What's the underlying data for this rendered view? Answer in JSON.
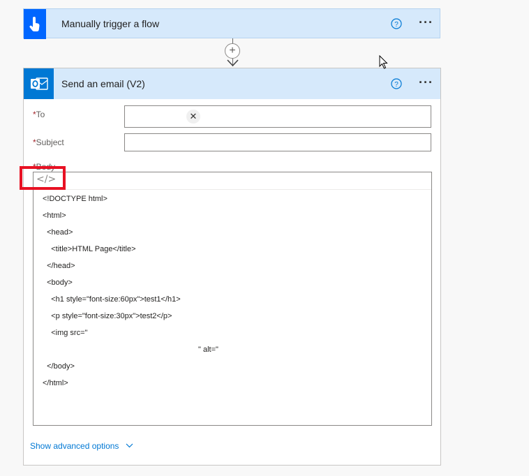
{
  "trigger": {
    "title": "Manually trigger a flow",
    "help_icon": "help-circle-icon",
    "more_icon": "more-options-icon"
  },
  "connector": {
    "add_symbol": "+"
  },
  "action": {
    "title": "Send an email (V2)",
    "help_icon": "help-circle-icon",
    "more_icon": "more-options-icon",
    "fields": {
      "to_label": "To",
      "subject_label": "Subject",
      "body_label": "Body",
      "required_marker": "*"
    },
    "code_toggle": "</>",
    "body_lines": [
      "<!DOCTYPE html>",
      "<html>",
      "  <head>",
      "    <title>HTML Page</title>",
      "  </head>",
      "  <body>",
      "    <h1 style=\"font-size:60px\">test1</h1>",
      "    <p style=\"font-size:30px\">test2</p>",
      "    <img src=\"",
      "\" alt=\"",
      "  </body>",
      "</html>"
    ],
    "advanced_label": "Show advanced options"
  },
  "colors": {
    "accent": "#0078d4",
    "header_bg": "#d6e9fb",
    "highlight": "#e81123"
  }
}
